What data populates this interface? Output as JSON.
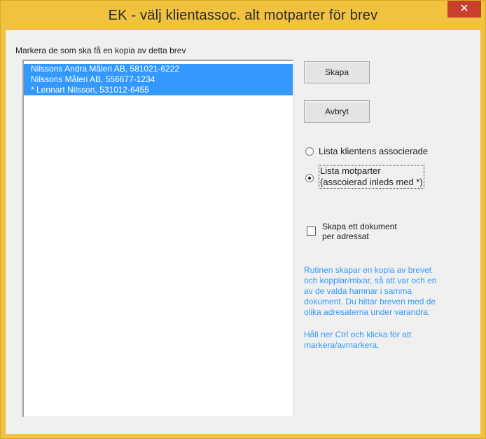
{
  "window": {
    "title": "EK - välj klientassoc. alt motparter för brev",
    "close_glyph": "✕",
    "accent_color": "#f0c23f"
  },
  "list": {
    "label": "Markera de som ska få en kopia av detta brev",
    "items": [
      "Nilssons Andra Måleri AB, 581021-6222",
      "Nilssons Måleri AB, 556677-1234",
      "* Lennart Nilsson, 531012-6455"
    ],
    "selection_color": "#3399ff"
  },
  "buttons": {
    "create": "Skapa",
    "cancel": "Avbryt"
  },
  "radios": {
    "option1": "Lista klientens associerade",
    "option2_line1": "Lista motparter",
    "option2_line2": "(asscoierad inleds med *)",
    "selected": "option2"
  },
  "checkbox": {
    "line1": "Skapa ett dokument",
    "line2": "per adressat",
    "checked": false
  },
  "info": {
    "para1_lines": [
      "Rutinen skapar en kopia av brevet",
      "och kopplar/mixar, så att var och en",
      "av de valda hamnar i samma",
      "dokument. Du hittar breven med de",
      "olika adresaterna under varandra."
    ],
    "para2_lines": [
      "Håll ner Ctrl och klicka för att",
      "markera/avmarkera."
    ],
    "color": "#3399ff"
  }
}
